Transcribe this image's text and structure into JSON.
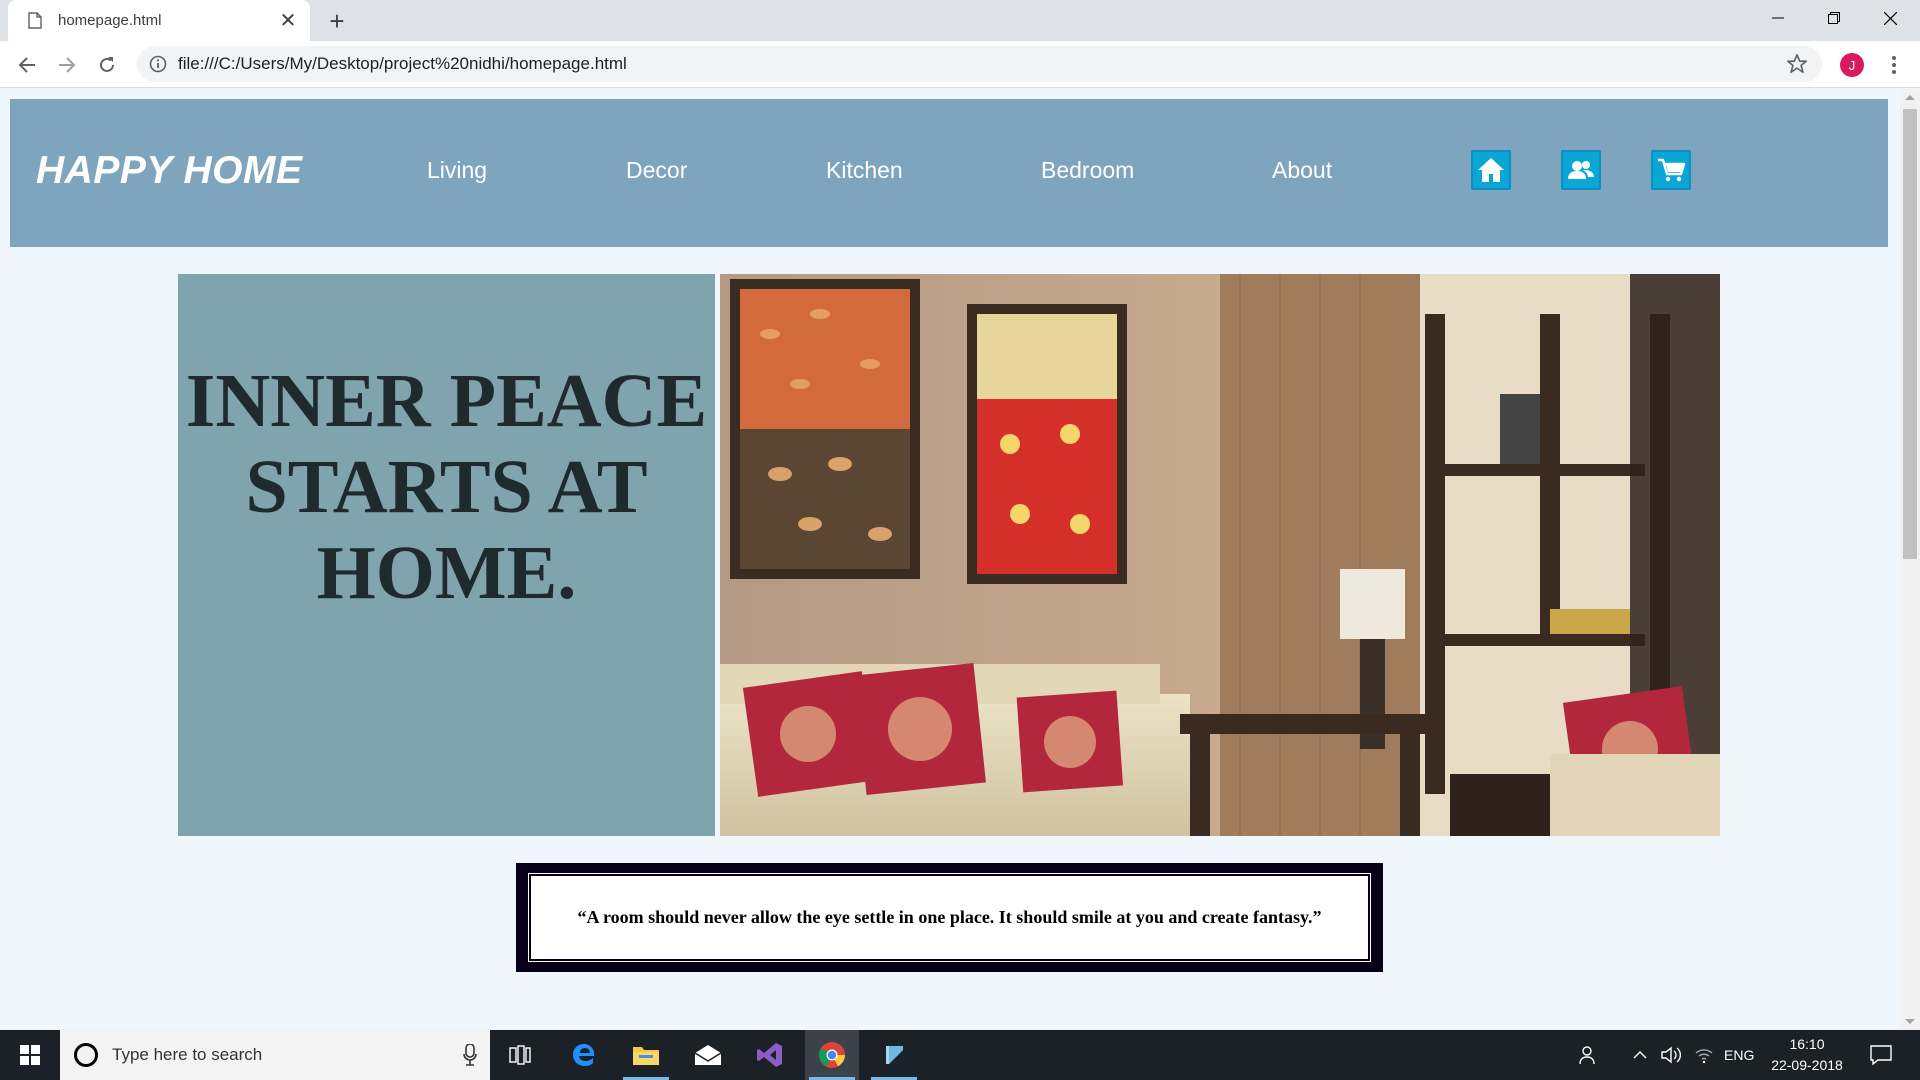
{
  "browser": {
    "tab_title": "homepage.html",
    "url": "file:///C:/Users/My/Desktop/project%20nidhi/homepage.html",
    "profile_initial": "J"
  },
  "site": {
    "logo": "HAPPY HOME",
    "nav": [
      "Living",
      "Decor",
      "Kitchen",
      "Bedroom",
      "About"
    ],
    "header_icons": [
      "home-icon",
      "users-icon",
      "cart-icon"
    ],
    "hero": {
      "heading": "INNER PEACE STARTS AT HOME."
    },
    "quote": "“A room should never allow the eye settle in one place. It should smile at you and create fantasy.”",
    "colors": {
      "header_bg": "#7ea5bd",
      "hero_panel_bg": "#80a4ad",
      "page_bg": "#f0f7fc",
      "icon_bg": "#0aa6d6",
      "quote_frame": "#080019"
    }
  },
  "taskbar": {
    "search_placeholder": "Type here to search",
    "language": "ENG",
    "time": "16:10",
    "date": "22-09-2018",
    "apps": [
      "task-view-icon",
      "edge-icon",
      "file-explorer-icon",
      "mail-icon",
      "visual-studio-icon",
      "chrome-icon",
      "notepad-icon"
    ]
  }
}
